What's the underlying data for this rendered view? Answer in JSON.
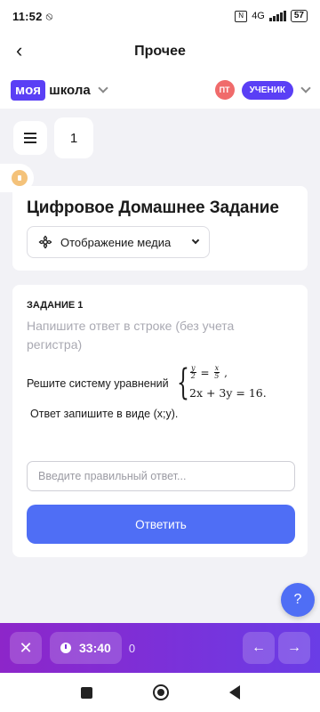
{
  "status_bar": {
    "time": "11:52",
    "network": "4G",
    "battery": "57"
  },
  "header": {
    "title": "Прочее"
  },
  "brand": {
    "part1": "моя",
    "part2": "школа"
  },
  "user": {
    "initials": "ПТ",
    "role": "УЧЕНИК"
  },
  "toolbar": {
    "page_number": "1"
  },
  "homework": {
    "title": "Цифровое Домашнее Задание",
    "media_button": "Отображение медиа"
  },
  "task": {
    "title": "ЗАДАНИЕ 1",
    "hint": "Напишите ответ в строке (без учета регистра)",
    "question_lead": "Решите систему уравнений",
    "eq1": {
      "num1": "y",
      "den1": "2",
      "num2": "x",
      "den2": "5"
    },
    "eq2": "2x + 3y = 16.",
    "question_tail": "Ответ запишите в виде (x;y).",
    "answer_placeholder": "Введите правильный ответ...",
    "submit_label": "Ответить"
  },
  "help": {
    "label": "?"
  },
  "bottom_bar": {
    "timer": "33:40",
    "counter": "0"
  },
  "colors": {
    "brand": "#5a3ff5",
    "accent": "#4f6ef5",
    "bottom_bar": "#7c30d8"
  }
}
